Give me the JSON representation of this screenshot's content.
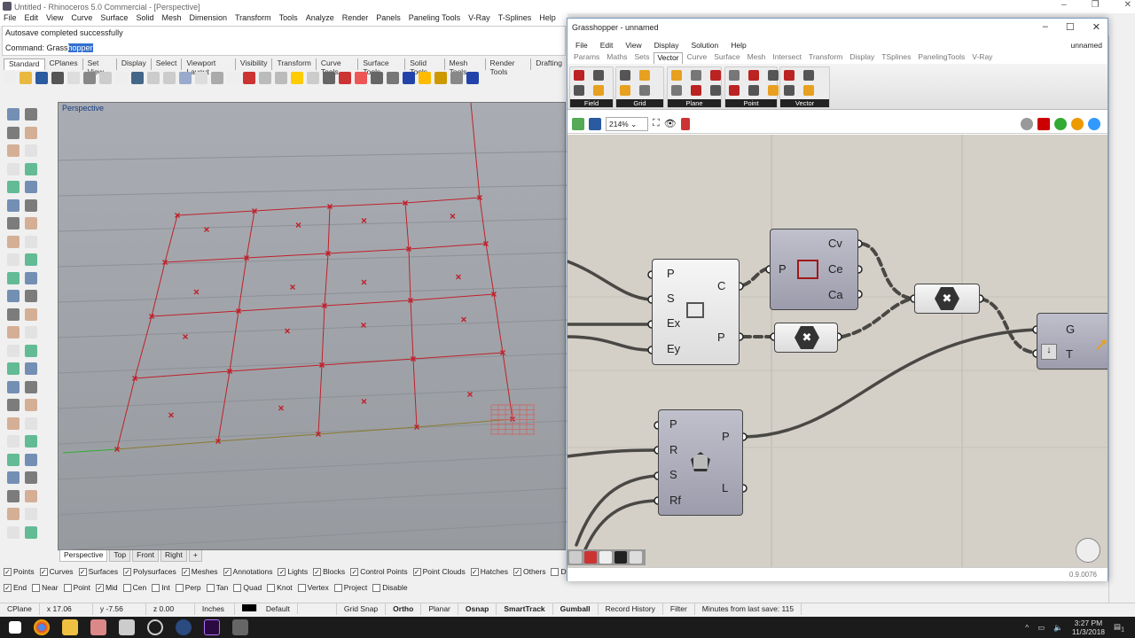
{
  "rhino": {
    "title": "Untitled - Rhinoceros 5.0 Commercial - [Perspective]",
    "menu": [
      "File",
      "Edit",
      "View",
      "Curve",
      "Surface",
      "Solid",
      "Mesh",
      "Dimension",
      "Transform",
      "Tools",
      "Analyze",
      "Render",
      "Panels",
      "Paneling Tools",
      "V-Ray",
      "T-Splines",
      "Help"
    ],
    "history": "Autosave completed successfully",
    "command_label": "Command: Grass",
    "command_selected": "hopper",
    "toolbar_tabs": [
      "Standard",
      "CPlanes",
      "Set View",
      "Display",
      "Select",
      "Viewport Layout",
      "Visibility",
      "Transform",
      "Curve Tools",
      "Surface Tools",
      "Solid Tools",
      "Mesh Tools",
      "Render Tools",
      "Drafting"
    ],
    "viewport_label": "Perspective",
    "viewport_tabs": [
      "Perspective",
      "Top",
      "Front",
      "Right",
      "+"
    ],
    "filters": [
      {
        "label": "Points",
        "on": true
      },
      {
        "label": "Curves",
        "on": true
      },
      {
        "label": "Surfaces",
        "on": true
      },
      {
        "label": "Polysurfaces",
        "on": true
      },
      {
        "label": "Meshes",
        "on": true
      },
      {
        "label": "Annotations",
        "on": true
      },
      {
        "label": "Lights",
        "on": true
      },
      {
        "label": "Blocks",
        "on": true
      },
      {
        "label": "Control Points",
        "on": true
      },
      {
        "label": "Point Clouds",
        "on": true
      },
      {
        "label": "Hatches",
        "on": true
      },
      {
        "label": "Others",
        "on": true
      },
      {
        "label": "Disable",
        "on": false
      }
    ],
    "osnaps": [
      {
        "label": "End",
        "on": true
      },
      {
        "label": "Near",
        "on": false
      },
      {
        "label": "Point",
        "on": false
      },
      {
        "label": "Mid",
        "on": true
      },
      {
        "label": "Cen",
        "on": false
      },
      {
        "label": "Int",
        "on": false
      },
      {
        "label": "Perp",
        "on": false
      },
      {
        "label": "Tan",
        "on": false
      },
      {
        "label": "Quad",
        "on": false
      },
      {
        "label": "Knot",
        "on": false
      },
      {
        "label": "Vertex",
        "on": false
      },
      {
        "label": "Project",
        "on": false
      },
      {
        "label": "Disable",
        "on": false
      }
    ],
    "status": {
      "cplane": "CPlane",
      "x": "x 17.06",
      "y": "y -7.56",
      "z": "z 0.00",
      "units": "Inches",
      "layer": "Default",
      "grid_snap": "Grid Snap",
      "ortho": "Ortho",
      "planar": "Planar",
      "osnap": "Osnap",
      "smarttrack": "SmartTrack",
      "gumball": "Gumball",
      "record_history": "Record History",
      "filter": "Filter",
      "save_info": "Minutes from last save: 115"
    }
  },
  "grasshopper": {
    "title": "Grasshopper - unnamed",
    "menu": [
      "File",
      "Edit",
      "View",
      "Display",
      "Solution",
      "Help"
    ],
    "doc_name": "unnamed",
    "tabs": [
      "Params",
      "Maths",
      "Sets",
      "Vector",
      "Curve",
      "Surface",
      "Mesh",
      "Intersect",
      "Transform",
      "Display",
      "TSplines",
      "PanelingTools",
      "V-Ray"
    ],
    "active_tab": "Vector",
    "groups": [
      "Field",
      "Grid",
      "Plane",
      "Point",
      "Vector"
    ],
    "zoom": "214%",
    "version": "0.9.0076",
    "components": {
      "rect": {
        "inputs": [
          "P",
          "S",
          "Ex",
          "Ey"
        ],
        "outputs": [
          "C",
          "P"
        ]
      },
      "area": {
        "inputs": [
          "P"
        ],
        "outputs": [
          "Cv",
          "Ce",
          "Ca"
        ]
      },
      "polygon": {
        "inputs": [
          "P",
          "R",
          "S",
          "Rf"
        ],
        "outputs": [
          "P",
          "L"
        ]
      },
      "move": {
        "inputs": [
          "G",
          "T"
        ]
      }
    }
  },
  "tray": {
    "time": "3:27 PM",
    "date": "11/3/2018",
    "notifications": "1"
  },
  "colors": {
    "accent": "#3370d0",
    "grid_red": "#c0202a",
    "canvas": "#d4d0c8"
  }
}
